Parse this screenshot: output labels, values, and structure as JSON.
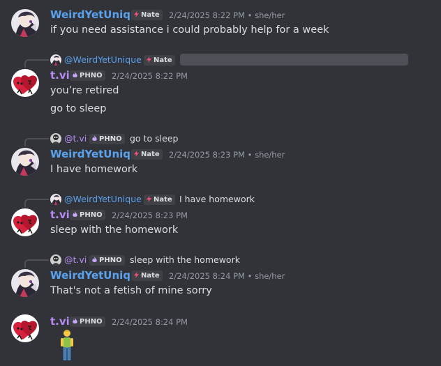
{
  "colors": {
    "background": "#313338",
    "weird_name": "#5aa2ee",
    "tvi_name": "#b58af2",
    "text": "#dbdee1",
    "muted": "#949ba4",
    "nate_tag_icon": "#f04f7a",
    "phno_tag_icon": "#c9a8ff"
  },
  "users": {
    "weird": {
      "name": "WeirdYetUnique",
      "reply_name": "@WeirdYetUnique",
      "tag": "Nate",
      "tag_icon": "lightning-icon",
      "pronouns": "she/her"
    },
    "tvi": {
      "name": "t.vi",
      "reply_name": "@t.vi",
      "tag": "PHNO",
      "tag_icon": "flame-icon"
    }
  },
  "separator": "•",
  "messages": [
    {
      "author": "WeirdYetUnique",
      "timestamp": "2/24/2025 8:22 PM",
      "pronouns": "she/her",
      "lines": [
        " if you need assistance i could probably help for a week"
      ]
    },
    {
      "author": "t.vi",
      "timestamp": "2/24/2025 8:22 PM",
      "reply_to": {
        "name": "@WeirdYetUnique",
        "tag": "Nate",
        "text": ""
      },
      "lines": [
        "you’re retired",
        "go to sleep"
      ]
    },
    {
      "author": "WeirdYetUnique",
      "timestamp": "2/24/2025 8:23 PM",
      "pronouns": "she/her",
      "reply_to": {
        "name": "@t.vi",
        "tag": "PHNO",
        "text": "go to sleep"
      },
      "lines": [
        "I have homework"
      ]
    },
    {
      "author": "t.vi",
      "timestamp": "2/24/2025 8:23 PM",
      "reply_to": {
        "name": "@WeirdYetUnique",
        "tag": "Nate",
        "text": "I have homework"
      },
      "lines": [
        "sleep with the homework"
      ]
    },
    {
      "author": "WeirdYetUnique",
      "timestamp": "2/24/2025 8:24 PM",
      "pronouns": "she/her",
      "reply_to": {
        "name": "@t.vi",
        "tag": "PHNO",
        "text": "sleep with the homework"
      },
      "lines": [
        "That's not a fetish of mine sorry"
      ]
    },
    {
      "author": "t.vi",
      "timestamp": "2/24/2025 8:24 PM",
      "lines": [],
      "attachment": "standing-person-emoji"
    }
  ]
}
